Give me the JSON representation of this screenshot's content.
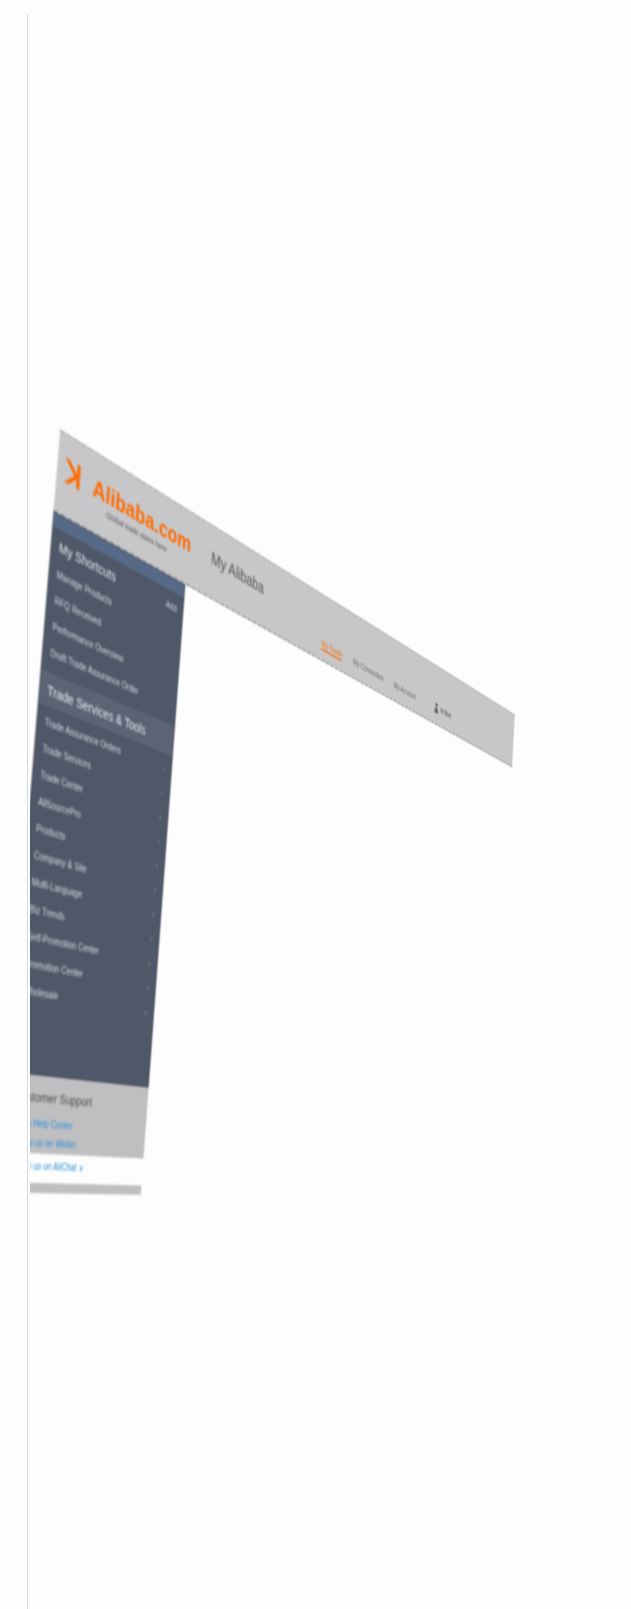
{
  "header": {
    "logo_text": "Alibaba.com",
    "logo_tagline": "Global trade starts here",
    "title": "My Alibaba",
    "tabs": [
      {
        "label": "My Trade",
        "active": true
      },
      {
        "label": "My Connection",
        "active": false
      },
      {
        "label": "My Account",
        "active": false
      }
    ],
    "user_label": "Hi Bert"
  },
  "sidebar": {
    "shortcuts": {
      "heading": "My Shortcuts",
      "add_label": "Add",
      "items": [
        "Manage Products",
        "RFQ Received",
        "Performance Overview",
        "Draft Trade Assurance Order"
      ]
    },
    "trade_services": {
      "heading": "Trade Services & Tools",
      "items": [
        "Trade Assurance Orders",
        "Trade Services",
        "Trade Center",
        "AllSourcePro",
        "Products",
        "Company & Site",
        "Multi-Language",
        "Biz Trends",
        "Self-Promotion Center",
        "Promotion Center",
        "Wholesale"
      ]
    }
  },
  "support": {
    "heading": "Customer Support",
    "links": [
      "Go to Help Center",
      "Follow us on Weibo",
      "Follow us on AliChat ∨"
    ]
  },
  "colors": {
    "accent": "#ff6a00",
    "sidebar_bg": "#4f5868",
    "link": "#2b8fd6"
  }
}
